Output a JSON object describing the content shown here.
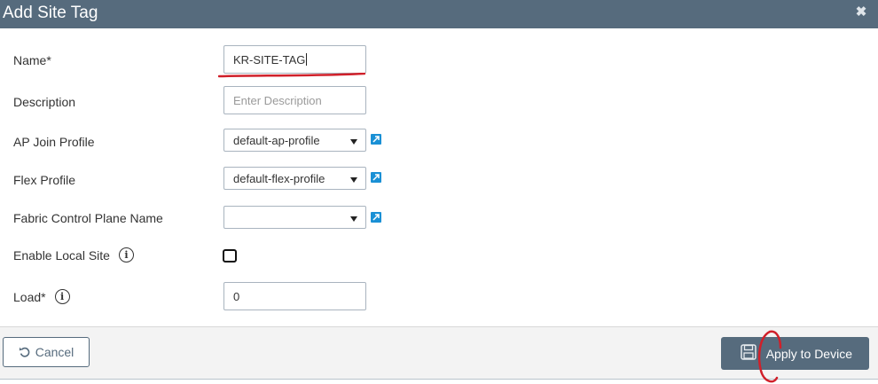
{
  "dialog": {
    "title": "Add Site Tag",
    "close_label": "✖"
  },
  "form": {
    "name": {
      "label": "Name*",
      "value": "KR-SITE-TAG"
    },
    "description": {
      "label": "Description",
      "placeholder": "Enter Description"
    },
    "ap_join_profile": {
      "label": "AP Join Profile",
      "value": "default-ap-profile"
    },
    "flex_profile": {
      "label": "Flex Profile",
      "value": "default-flex-profile"
    },
    "fabric_control_plane": {
      "label": "Fabric Control Plane Name",
      "value": ""
    },
    "enable_local_site": {
      "label": "Enable Local Site",
      "checked": false
    },
    "load": {
      "label": "Load*",
      "value": "0"
    }
  },
  "footer": {
    "cancel_label": "Cancel",
    "apply_label": "Apply to Device"
  },
  "icons": {
    "info": "info-icon",
    "external_link": "external-link-icon",
    "undo": "undo-icon",
    "save": "save-icon"
  },
  "colors": {
    "header_bg": "#566b7d",
    "link_icon": "#1a90d5",
    "annotation": "#d0202a"
  }
}
